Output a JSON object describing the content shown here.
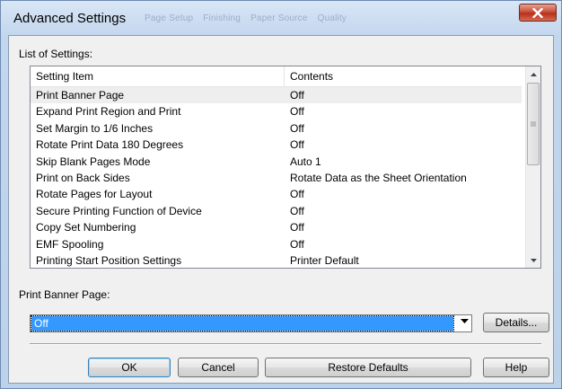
{
  "window": {
    "title": "Advanced Settings",
    "ghost_tabs": [
      "Page Setup",
      "Finishing",
      "Paper Source",
      "Quality"
    ]
  },
  "list": {
    "label": "List of Settings:",
    "columns": [
      "Setting Item",
      "Contents"
    ],
    "rows": [
      {
        "item": "Print Banner Page",
        "contents": "Off"
      },
      {
        "item": "Expand Print Region and Print",
        "contents": "Off"
      },
      {
        "item": "Set Margin to 1/6 Inches",
        "contents": "Off"
      },
      {
        "item": "Rotate Print Data 180 Degrees",
        "contents": "Off"
      },
      {
        "item": "Skip Blank Pages Mode",
        "contents": "Auto 1"
      },
      {
        "item": "Print on Back Sides",
        "contents": "Rotate Data as the Sheet Orientation"
      },
      {
        "item": "Rotate Pages for Layout",
        "contents": "Off"
      },
      {
        "item": "Secure Printing Function of Device",
        "contents": "Off"
      },
      {
        "item": "Copy Set Numbering",
        "contents": "Off"
      },
      {
        "item": "EMF Spooling",
        "contents": "Off"
      },
      {
        "item": "Printing Start Position Settings",
        "contents": "Printer Default"
      }
    ],
    "selected_index": 0
  },
  "setting_detail": {
    "label": "Print Banner Page:",
    "value": "Off",
    "details_button": "Details..."
  },
  "buttons": {
    "ok": "OK",
    "cancel": "Cancel",
    "restore": "Restore Defaults",
    "help": "Help"
  },
  "colors": {
    "selection": "#3399ff",
    "close_button": "#c7503a"
  }
}
